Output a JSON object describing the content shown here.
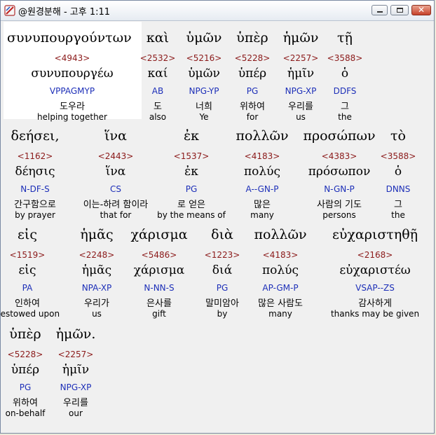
{
  "window": {
    "title": "@원경분해 - 고후 1:11",
    "minimize": "",
    "maximize": "",
    "close": "✕"
  },
  "words": [
    {
      "greek": "συνυπουργούντων",
      "strong": "<4943>",
      "lemma": "συνυπουργέω",
      "morph": "VPPAGMYP",
      "kr": "도우라",
      "en": "helping together"
    },
    {
      "greek": "καὶ",
      "strong": "<2532>",
      "lemma": "καί",
      "morph": "AB",
      "kr": "도",
      "en": "also"
    },
    {
      "greek": "ὑμῶν",
      "strong": "<5216>",
      "lemma": "ὑμῶν",
      "morph": "NPG-YP",
      "kr": "너희",
      "en": "Ye"
    },
    {
      "greek": "ὑπὲρ",
      "strong": "<5228>",
      "lemma": "ὑπέρ",
      "morph": "PG",
      "kr": "위하여",
      "en": "for"
    },
    {
      "greek": "ἡμῶν",
      "strong": "<2257>",
      "lemma": "ἡμῖν",
      "morph": "NPG-XP",
      "kr": "우리를",
      "en": "us"
    },
    {
      "greek": "τῇ",
      "strong": "<3588>",
      "lemma": "ὁ",
      "morph": "DDFS",
      "kr": "그",
      "en": "the"
    },
    {
      "greek": "δεήσει,",
      "strong": "<1162>",
      "lemma": "δέησις",
      "morph": "N-DF-S",
      "kr": "간구함으로",
      "en": "by prayer"
    },
    {
      "greek": "ἵνα",
      "strong": "<2443>",
      "lemma": "ἵνα",
      "morph": "CS",
      "kr": "이는-하려 함이라",
      "en": "that for"
    },
    {
      "greek": "ἐκ",
      "strong": "<1537>",
      "lemma": "ἐκ",
      "morph": "PG",
      "kr": "로 얻은",
      "en": "by the means of"
    },
    {
      "greek": "πολλῶν",
      "strong": "<4183>",
      "lemma": "πολύς",
      "morph": "A--GN-P",
      "kr": "많은",
      "en": "many"
    },
    {
      "greek": "προσώπων",
      "strong": "<4383>",
      "lemma": "πρόσωπον",
      "morph": "N-GN-P",
      "kr": "사람의 기도",
      "en": "persons"
    },
    {
      "greek": "τὸ",
      "strong": "<3588>",
      "lemma": "ὁ",
      "morph": "DNNS",
      "kr": "그",
      "en": "the"
    },
    {
      "greek": "εἰς",
      "strong": "<1519>",
      "lemma": "εἰς",
      "morph": "PA",
      "kr": "인하여",
      "en": "bestowed upon"
    },
    {
      "greek": "ἡμᾶς",
      "strong": "<2248>",
      "lemma": "ἡμᾶς",
      "morph": "NPA-XP",
      "kr": "우리가",
      "en": "us"
    },
    {
      "greek": "χάρισμα",
      "strong": "<5486>",
      "lemma": "χάρισμα",
      "morph": "N-NN-S",
      "kr": "은사를",
      "en": "gift"
    },
    {
      "greek": "διὰ",
      "strong": "<1223>",
      "lemma": "διά",
      "morph": "PG",
      "kr": "말미암아",
      "en": "by"
    },
    {
      "greek": "πολλῶν",
      "strong": "<4183>",
      "lemma": "πολύς",
      "morph": "AP-GM-P",
      "kr": "많은 사람도",
      "en": "many"
    },
    {
      "greek": "εὐχαριστηθῇ",
      "strong": "<2168>",
      "lemma": "εὐχαριστέω",
      "morph": "VSAP--ZS",
      "kr": "감사하게",
      "en": "thanks may be given"
    },
    {
      "greek": "ὑπὲρ",
      "strong": "<5228>",
      "lemma": "ὑπέρ",
      "morph": "PG",
      "kr": "위하여",
      "en": "on-behalf"
    },
    {
      "greek": "ἡμῶν.",
      "strong": "<2257>",
      "lemma": "ἡμῖν",
      "morph": "NPG-XP",
      "kr": "우리를",
      "en": "our"
    }
  ]
}
